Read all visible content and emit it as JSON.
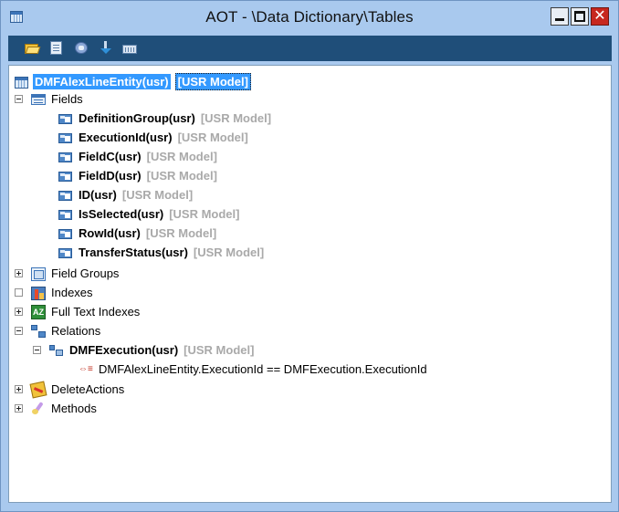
{
  "window": {
    "title": "AOT - \\Data Dictionary\\Tables",
    "buttons": {
      "minimize_icon": "minimize-icon",
      "maximize_icon": "maximize-icon",
      "close_glyph": "✕"
    }
  },
  "toolbar": {
    "icons": [
      "open-icon",
      "properties-icon",
      "compile-icon",
      "import-icon",
      "export-icon"
    ]
  },
  "tree": {
    "root": {
      "name": "DMFAlexLineEntity(usr)",
      "layer": "[USR Model]"
    },
    "fields": {
      "label": "Fields",
      "items": [
        {
          "name": "DefinitionGroup(usr)",
          "layer": "[USR Model]"
        },
        {
          "name": "ExecutionId(usr)",
          "layer": "[USR Model]"
        },
        {
          "name": "FieldC(usr)",
          "layer": "[USR Model]"
        },
        {
          "name": "FieldD(usr)",
          "layer": "[USR Model]"
        },
        {
          "name": "ID(usr)",
          "layer": "[USR Model]"
        },
        {
          "name": "IsSelected(usr)",
          "layer": "[USR Model]"
        },
        {
          "name": "RowId(usr)",
          "layer": "[USR Model]"
        },
        {
          "name": "TransferStatus(usr)",
          "layer": "[USR Model]"
        }
      ]
    },
    "field_groups": "Field Groups",
    "indexes": "Indexes",
    "full_text_indexes": "Full Text Indexes",
    "relations": {
      "label": "Relations",
      "relation": {
        "name": "DMFExecution(usr)",
        "layer": "[USR Model]"
      },
      "link": "DMFAlexLineEntity.ExecutionId == DMFExecution.ExecutionId",
      "link_glyph": "⇔≡"
    },
    "delete_actions": "DeleteActions",
    "methods": "Methods",
    "fti_glyph": "AZ"
  },
  "colors": {
    "selection": "#3399ff",
    "layer_text": "#a9a9a9",
    "toolbar_bg": "#1f4e79",
    "window_frame": "#a9c9ee"
  }
}
